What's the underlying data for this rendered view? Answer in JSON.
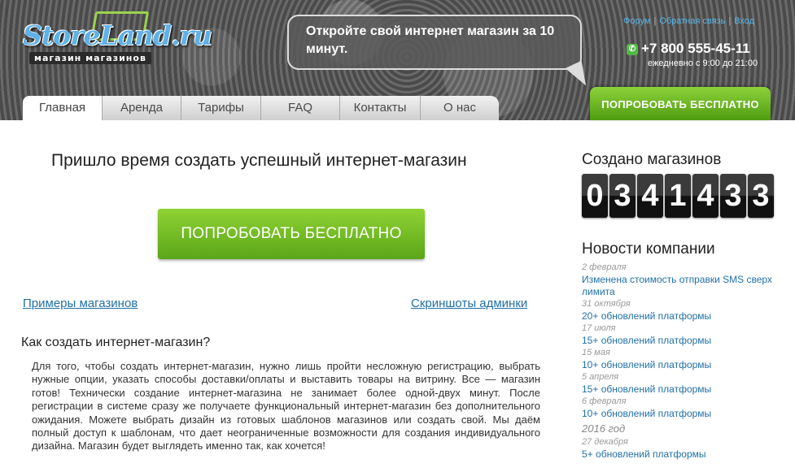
{
  "header": {
    "logo_text": "StoreLand.ru",
    "logo_tagline": "магазин магазинов",
    "slogan": "Откройте свой интернет магазин за 10 минут.",
    "top_links": [
      "Форум",
      "Обратная связь",
      "Вход"
    ],
    "phone": "+7 800 555-45-11",
    "hours": "ежедневно с 9:00 до 21:00",
    "try_button": "ПОПРОБОВАТЬ БЕСПЛАТНО"
  },
  "nav": {
    "tabs": [
      {
        "label": "Главная"
      },
      {
        "label": "Аренда"
      },
      {
        "label": "Тарифы"
      },
      {
        "label": "FAQ"
      },
      {
        "label": "Контакты"
      },
      {
        "label": "О нас"
      }
    ]
  },
  "main": {
    "title": "Пришло время создать успешный интернет-магазин",
    "cta": "ПОПРОБОВАТЬ БЕСПЛАТНО",
    "link_examples": "Примеры магазинов",
    "link_screenshots": "Скриншоты админки",
    "how_title": "Как создать интернет-магазин?",
    "how_text": "Для того, чтобы создать интернет-магазин, нужно лишь пройти несложную регистрацию, выбрать нужные опции, указать способы доставки/оплаты и выставить товары на витрину. Все — магазин готов! Технически создание интернет-магазина не занимает более одной-двух минут. После регистрации в системе сразу же получаете функциональный интернет-магазин без дополнительного ожидания. Можете выбрать дизайн из готовых шаблонов магазинов или создать свой. Мы даём полный доступ к шаблонам, что дает неограниченные возможности для создания индивидуального дизайна. Магазин будет выглядеть именно так, как хочется!"
  },
  "sidebar": {
    "created_title": "Создано магазинов",
    "counter": [
      "0",
      "3",
      "4",
      "1",
      "4",
      "3",
      "3"
    ],
    "news_title": "Новости компании",
    "news": [
      {
        "date": "2 февраля",
        "text": "Изменена стоимость отправки SMS сверх лимита"
      },
      {
        "date": "31 октября",
        "text": "20+ обновлений платформы"
      },
      {
        "date": "17 июля",
        "text": "15+ обновлений платформы"
      },
      {
        "date": "15 мая",
        "text": "10+ обновлений платформы"
      },
      {
        "date": "5 апреля",
        "text": "15+ обновлений платформы"
      },
      {
        "date": "6 февраля",
        "text": "10+ обновлений платформы"
      }
    ],
    "year": "2016 год",
    "news_2016": [
      {
        "date": "27 декабря",
        "text": "5+ обновлений платформы"
      }
    ]
  }
}
